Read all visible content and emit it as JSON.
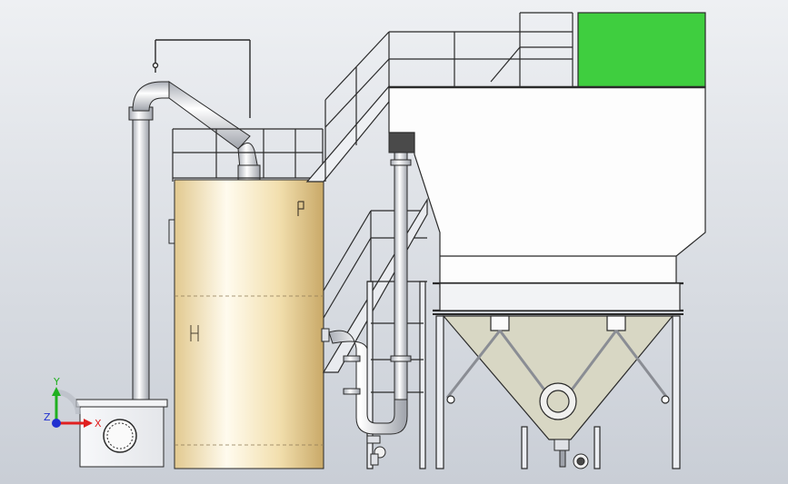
{
  "viewport": {
    "background_top": "#eef0f3",
    "background_bottom": "#c9ced6"
  },
  "triad": {
    "x_label": "X",
    "y_label": "Y",
    "z_label": "Z",
    "x_color": "#e02020",
    "y_color": "#20b020",
    "z_color": "#2030d0"
  },
  "colors": {
    "tank_shell": "#f2dfae",
    "tank_highlight": "#fffbee",
    "steel": "#eceef2",
    "steel_shade": "#b8bcc4",
    "hopper": "#d8d7c4",
    "green_panel": "#3fce3f",
    "outline": "#2a2a2a",
    "dark_block": "#4a4a4a"
  },
  "icons": {
    "triad": "coordinate-triad-icon",
    "valve": "valve-icon"
  }
}
